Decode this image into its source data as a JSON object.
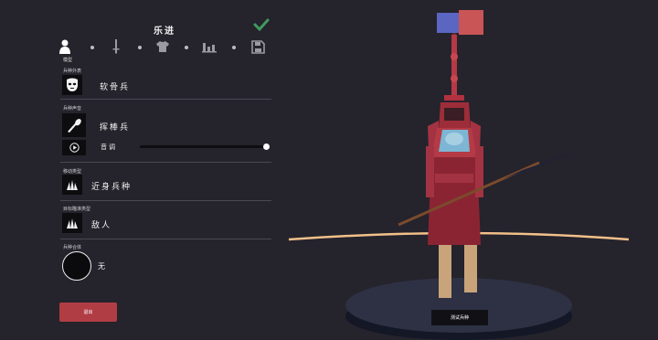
{
  "panel": {
    "title": "乐进",
    "steps": [
      {
        "icon": "person-icon",
        "label": "模型",
        "active": true
      },
      {
        "icon": "sword-icon",
        "label": "",
        "active": false
      },
      {
        "icon": "shirt-icon",
        "label": "",
        "active": false
      },
      {
        "icon": "stats-icon",
        "label": "",
        "active": false
      },
      {
        "icon": "save-icon",
        "label": "",
        "active": false
      }
    ],
    "sections": {
      "unit_appearance": {
        "label": "兵种外表",
        "value": "软骨兵"
      },
      "unit_voice": {
        "label": "兵种声音",
        "value": "挥棒兵",
        "pitch_label": "音调",
        "pitch_level": 1.0
      },
      "movement_type": {
        "label": "移动类型",
        "value": "近身兵种"
      },
      "target_priority": {
        "label": "目标瞄准类型",
        "value": "敌人"
      },
      "unit_mount": {
        "label": "兵种合体",
        "value": "无"
      }
    },
    "exit_label": "退出"
  },
  "scene": {
    "team_colors": [
      "#5a66c2",
      "#c95557"
    ],
    "test_unit_label": "测试兵种"
  },
  "colors": {
    "background": "#25232c",
    "accent_red": "#b13d44",
    "check_green": "#3f9a5e"
  }
}
